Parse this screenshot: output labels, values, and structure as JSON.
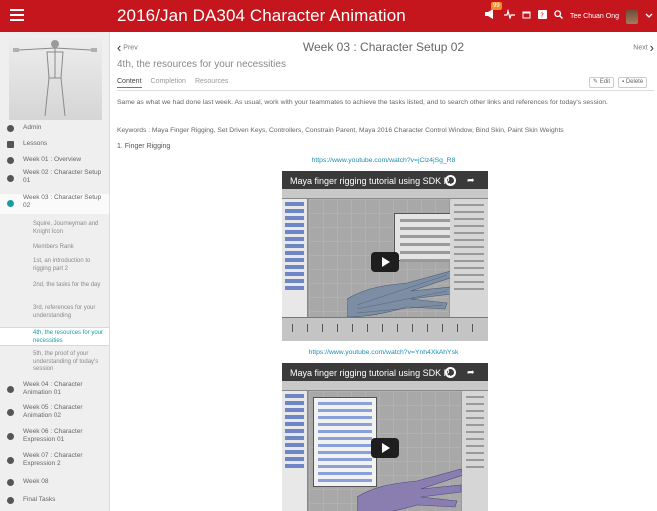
{
  "topbar": {
    "title": "2016/Jan DA304 Character Animation",
    "notification_count": "99",
    "user_name": "Tee Chuan Ong",
    "icons": [
      "hamburger-icon",
      "announce-icon",
      "pulse-icon",
      "calendar-icon",
      "help-icon",
      "search-icon",
      "avatar",
      "chevron-down-icon"
    ]
  },
  "sidebar": {
    "items": [
      {
        "label": "Admin",
        "icon": "gear-icon"
      },
      {
        "label": "Lessons",
        "icon": "book-icon"
      },
      {
        "label": "Week 01 : Overview",
        "icon": "chevron-right-icon"
      },
      {
        "label": "Week 02 : Character Setup 01",
        "icon": "chevron-right-icon"
      },
      {
        "label": "Week 03 : Character Setup 02",
        "icon": "chevron-down-icon",
        "active": true
      }
    ],
    "subitems": [
      {
        "label": "Squire, Journeyman and Knight Icon"
      },
      {
        "label": "Members Rank"
      },
      {
        "label": "1st, an introduction to rigging part 2"
      },
      {
        "label": "2nd, the tasks for the day"
      },
      {
        "label": "3rd, references for your understanding"
      },
      {
        "label": "4th, the resources for your necessities",
        "current": true
      },
      {
        "label": "5th, the proof of your understanding of today's session"
      }
    ],
    "items_after": [
      {
        "label": "Week 04 : Character Animation 01"
      },
      {
        "label": "Week 05 : Character Animation 02"
      },
      {
        "label": "Week 06 : Character Expression 01"
      },
      {
        "label": "Week 07 : Character Expression 2"
      },
      {
        "label": "Week 08"
      },
      {
        "label": "Final Tasks"
      }
    ]
  },
  "main": {
    "prev_label": "Prev",
    "next_label": "Next",
    "page_title": "Week 03 : Character Setup 02",
    "subtitle": "4th, the resources for your necessities",
    "tabs": [
      "Content",
      "Completion",
      "Resources"
    ],
    "active_tab": "Content",
    "edit_label": "Edit",
    "delete_label": "Delete",
    "body_text": "Same as what we had done last week. As usual, work with your teammates to achieve the tasks listed, and to search other links and references for today's session.",
    "keywords": "Keywords : Maya Finger Rigging, Set Driven Keys, Controllers, Constrain Parent, Maya 2016 Character Control Window, Bind Skin, Paint Skin Weights",
    "section_heading": "1. Finger Rigging",
    "videos": [
      {
        "url": "https://www.youtube.com/watch?v=jClz4jSg_R8",
        "title": "Maya finger rigging tutorial using SDK P..."
      },
      {
        "url": "https://www.youtube.com/watch?v=Ynh4XkAhYsk",
        "title": "Maya finger rigging tutorial using SDK P..."
      }
    ]
  }
}
